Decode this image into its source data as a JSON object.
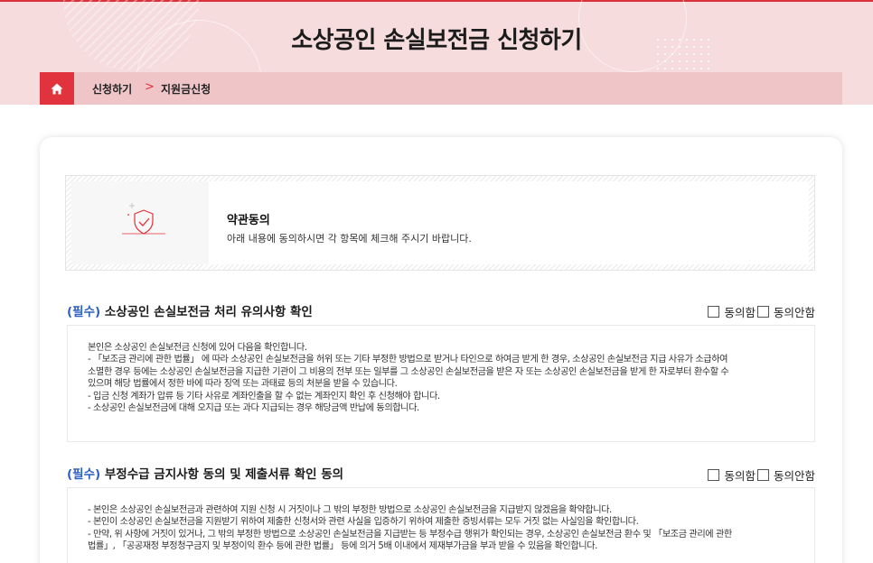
{
  "header": {
    "title": "소상공인 손실보전금 신청하기"
  },
  "breadcrumb": {
    "home_icon": "home-icon",
    "items": [
      "신청하기",
      "지원금신청"
    ],
    "separator": ">"
  },
  "terms": {
    "icon": "shield-check-icon",
    "title": "약관동의",
    "description": "아래 내용에 동의하시면 각 항목에 체크해 주시기 바랍니다."
  },
  "sections": [
    {
      "required_label": "(필수)",
      "title": "소상공인 손실보전금 처리 유의사항 확인",
      "agree_label": "동의함",
      "disagree_label": "동의안함",
      "lines": [
        "본인은 소상공인 손실보전금 신청에 있어 다음을 확인합니다.",
        "- 「보조금 관리에 관한 법률」 에 따라 소상공인 손실보전금을 허위 또는 기타 부정한 방법으로 받거나 타인으로 하여금 받게 한 경우, 소상공인 손실보전금 지급 사유가 소급하여",
        "소멸한 경우 등에는 소상공인 손실보전금을 지급한 기관이 그 비용의 전부 또는 일부를 그 소상공인 손실보전금을 받은 자 또는 소상공인 손실보전금을 받게 한 자로부터 환수할 수",
        "있으며 해당 법률에서 정한 바에 따라 징역 또는 과태료 등의 처분을 받을 수 있습니다.",
        "- 입금 신청 계좌가 압류 등 기타 사유로 계좌인출을 할 수 없는 계좌인지 확인 후 신청해야 합니다.",
        "- 소상공인 손실보전금에 대해 오지급 또는 과다 지급되는 경우 해당금액 반납에 동의합니다."
      ]
    },
    {
      "required_label": "(필수)",
      "title": "부정수급 금지사항 동의 및 제출서류 확인 동의",
      "agree_label": "동의함",
      "disagree_label": "동의안함",
      "lines": [
        "- 본인은 소상공인 손실보전금과 관련하여 지원 신청 시 거짓이나 그 밖의 부정한 방법으로 소상공인 손실보전금을 지급받지 않겠음을 확약합니다.",
        "- 본인이 소상공인 손실보전금을 지원받기 위하여 제출한 신청서와 관련 사실을 입증하기 위하여 제출한 증빙서류는 모두 거짓 없는 사실임을 확인합니다.",
        "- 만약, 위 사항에 거짓이 있거나, 그 밖의 부정한 방법으로 소상공인 손실보전금을 지급받는 등 부정수급 행위가 확인되는 경우, 소상공인 손실보전금 환수 및 「보조금 관리에 관한",
        "법률」, 「공공재정 부정청구금지 및 부정이익 환수 등에 관한 법률」 등에 의거 5배 이내에서 제재부가금을 부과 받을 수 있음을 확인합니다."
      ]
    }
  ]
}
